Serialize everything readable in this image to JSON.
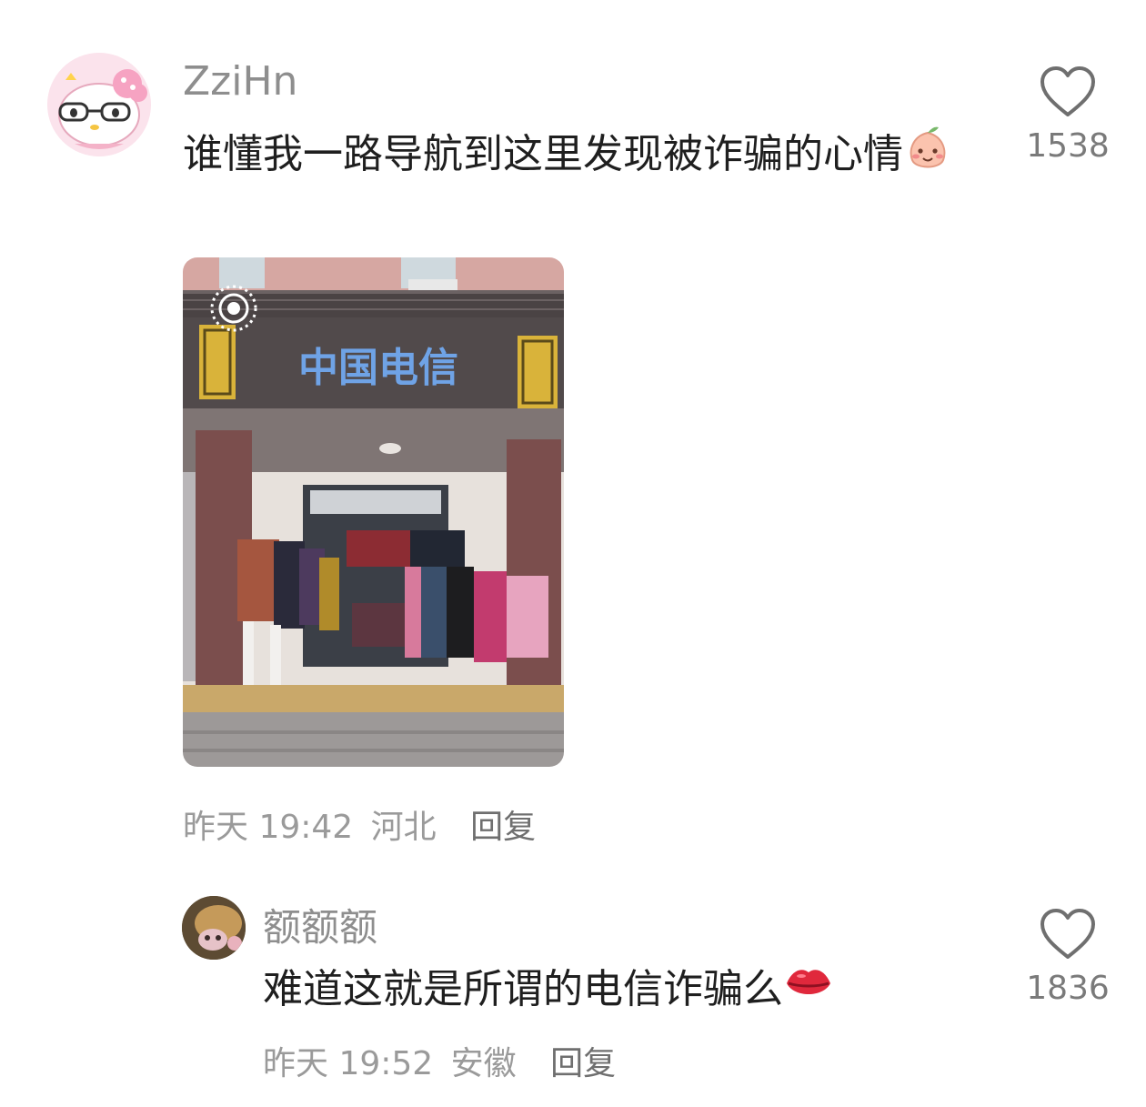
{
  "comments": [
    {
      "username": "ZziHn",
      "text": "谁懂我一路导航到这里发现被诈骗的心情",
      "time": "昨天 19:42",
      "location": "河北",
      "reply_label": "回复",
      "like_count": "1538",
      "avatar_icon": "hello-kitty-avatar",
      "emoji_icon": "peach-face-emoji"
    },
    {
      "username": "额额额",
      "text": "难道这就是所谓的电信诈骗么",
      "time": "昨天 19:52",
      "location": "安徽",
      "reply_label": "回复",
      "like_count": "1836",
      "avatar_icon": "plush-avatar",
      "emoji_icon": "lips-emoji"
    }
  ],
  "photo": {
    "sign_text": "中国电信",
    "live_icon": "live-photo-icon"
  }
}
